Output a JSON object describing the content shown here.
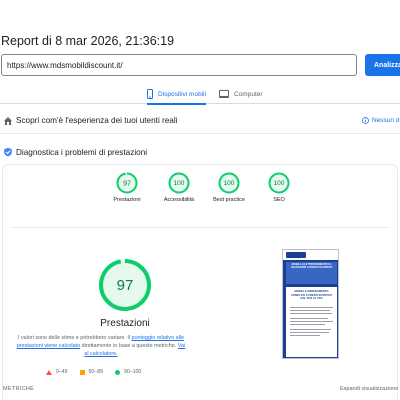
{
  "report": {
    "title": "Report di 8 mar 2026, 21:36:19"
  },
  "url_bar": {
    "value": "https://www.mdsmobildiscount.it/",
    "button_label": "Analizza"
  },
  "tabs": [
    {
      "label": "Dispositivi mobili",
      "icon": "smartphone-icon",
      "selected": true
    },
    {
      "label": "Computer",
      "icon": "desktop-icon",
      "selected": false
    }
  ],
  "sections": {
    "real_users": {
      "text": "Scopri com'è l'esperienza dei tuoi utenti reali",
      "icon": "users-icon",
      "link": "Nessun d"
    },
    "diagnostics": {
      "text": "Diagnostica i problemi di prestazioni",
      "icon": "lighthouse-icon"
    }
  },
  "categories": [
    {
      "score": "97",
      "label": "Prestazioni"
    },
    {
      "score": "100",
      "label": "Accessibilità"
    },
    {
      "score": "100",
      "label": "Best practice"
    },
    {
      "score": "100",
      "label": "SEO"
    }
  ],
  "performance": {
    "score": "97",
    "label": "Prestazioni",
    "desc_part1": "I valori sono delle stime e potrebbero variare. Il ",
    "desc_link1": "punteggio relativo alle prestazioni viene calcolato",
    "desc_part2": " direttamente in base a queste metriche. ",
    "desc_link2": "Vai al calcolatore."
  },
  "legend": [
    {
      "range": "0–49",
      "shape": "triangle",
      "color": "#ff4e42"
    },
    {
      "range": "50–89",
      "shape": "square",
      "color": "#ffa400"
    },
    {
      "range": "90–100",
      "shape": "circle",
      "color": "#0cce6b"
    }
  ],
  "footer": {
    "metrics_label": "METRICHE",
    "expand_label": "Espandi visualizzazione"
  },
  "screenshot": {
    "headline": "MOBILI, ELETTRODOMESTICI E ACCESSORI A PREZZI SCONTATI",
    "subhead": "MOBILI & ARREDAMENTO COMPLETI A PREZZI SCONTATI DAL 50% AL 70%"
  },
  "colors": {
    "accent": "#1a73e8",
    "pass": "#0cce6b",
    "pass_text": "#0c7c3c",
    "pass_fill": "#e6f9ee"
  }
}
